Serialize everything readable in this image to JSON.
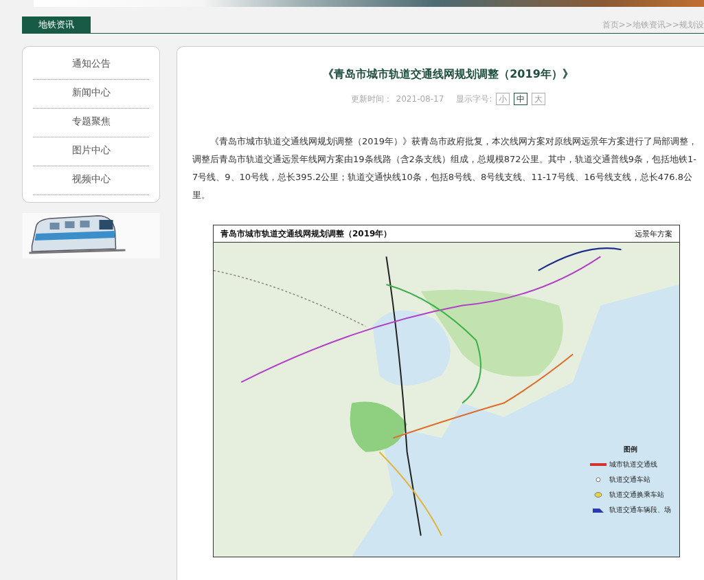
{
  "header": {
    "section_tab": "地铁资讯",
    "breadcrumb": "首页>>地铁资讯>>规划设"
  },
  "sidebar": {
    "items": [
      {
        "label": "通知公告"
      },
      {
        "label": "新闻中心"
      },
      {
        "label": "专题聚焦"
      },
      {
        "label": "图片中心"
      },
      {
        "label": "视频中心"
      }
    ]
  },
  "article": {
    "title": "《青岛市城市轨道交通线网规划调整（2019年）》",
    "updated_label": "更新时间：",
    "updated": "2021-08-17",
    "font_size_label": "显示字号:",
    "font_sizes": [
      {
        "label": "小",
        "selected": false
      },
      {
        "label": "中",
        "selected": true
      },
      {
        "label": "大",
        "selected": false
      }
    ],
    "body": "《青岛市城市轨道交通线网规划调整（2019年）》获青岛市政府批复，本次线网方案对原线网远景年方案进行了局部调整，调整后青岛市轨道交通远景年线网方案由19条线路（含2条支线）组成，总规模872公里。其中，轨道交通普线9条，包括地铁1-7号线、9、10号线，总长395.2公里；轨道交通快线10条，包括8号线、8号线支线、11-17号线、16号线支线，总长476.8公里。",
    "map": {
      "title": "青岛市城市轨道交通线网规划调整（2019年）",
      "subtitle": "远景年方案",
      "legend_title": "图例",
      "legend": [
        {
          "kind": "line",
          "label": "城市轨道交通线"
        },
        {
          "kind": "station",
          "label": "轨道交通车站"
        },
        {
          "kind": "interchange",
          "label": "轨道交通换乘车站"
        },
        {
          "kind": "depot",
          "label": "轨道交通车辆段、场"
        }
      ]
    }
  }
}
